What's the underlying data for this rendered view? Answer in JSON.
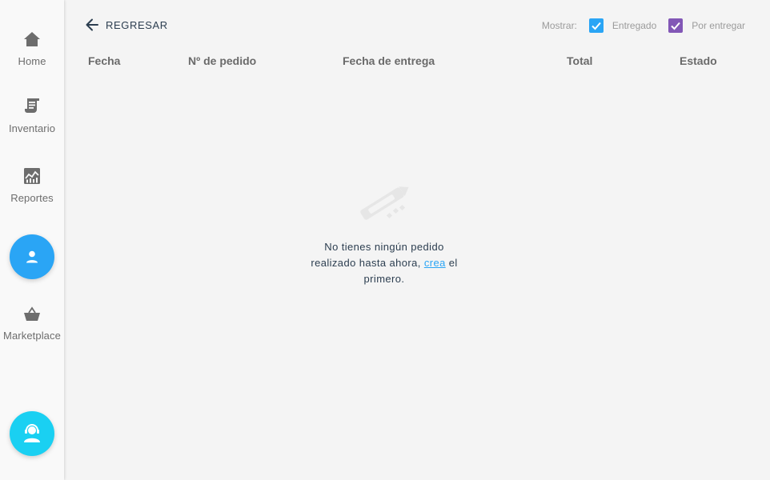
{
  "sidebar": {
    "items": [
      {
        "label": "Home",
        "icon": "home-icon"
      },
      {
        "label": "Inventario",
        "icon": "receipt-icon"
      },
      {
        "label": "Reportes",
        "icon": "chart-icon"
      },
      {
        "label": "Marketplace",
        "icon": "basket-icon"
      }
    ],
    "profile_icon": "person-icon",
    "support_icon": "support-agent-icon"
  },
  "header": {
    "back_label": "REGRESAR",
    "show_label": "Mostrar:",
    "filters": [
      {
        "label": "Entregado",
        "checked": true,
        "color": "#2aa5f5"
      },
      {
        "label": "Por entregar",
        "checked": true,
        "color": "#8257b6"
      }
    ]
  },
  "table": {
    "columns": [
      "Fecha",
      "Nº de pedido",
      "Fecha de entrega",
      "Total",
      "Estado"
    ],
    "rows": []
  },
  "empty_state": {
    "icon": "pencil-icon",
    "line1": "No tienes ningún pedido",
    "line2_prefix": "realizado hasta ahora, ",
    "link": "crea",
    "line2_suffix": " el",
    "line3": "primero."
  },
  "colors": {
    "accent": "#2aa5f5",
    "accent_cyan": "#1ad0f2",
    "purple": "#8257b6",
    "text_dark": "#2c3e50"
  }
}
